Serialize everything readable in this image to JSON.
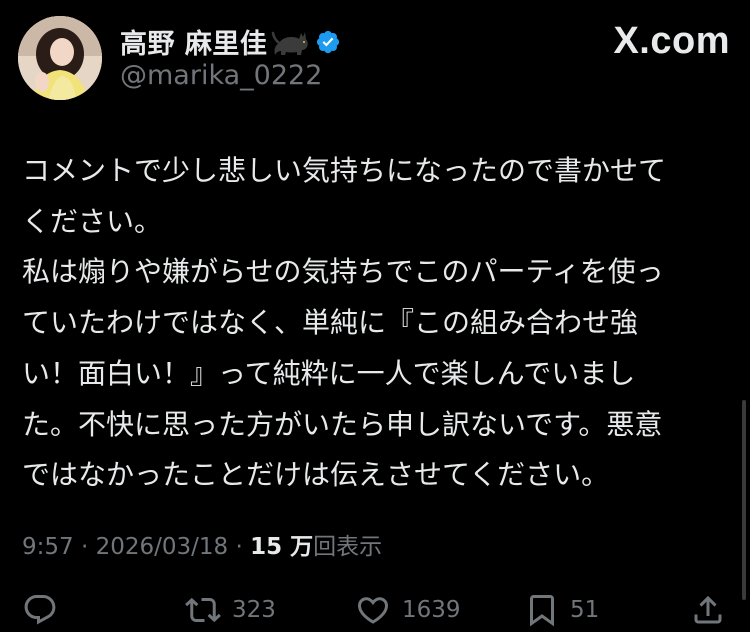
{
  "header": {
    "display_name": "高野 麻里佳",
    "handle": "@marika_0222",
    "site_logo": "X.com",
    "icons": [
      "black-cat-emoji-icon",
      "verified-badge-icon"
    ],
    "verified_color": "#1d9bf0"
  },
  "tweet": {
    "lines": [
      "コメントで少し悲しい気持ちになったので書かせて",
      "ください。",
      "私は煽りや嫌がらせの気持ちでこのパーティを使っ",
      "ていたわけではなく、単純に『この組み合わせ強",
      "い！面白い！』って純粋に一人で楽しんでいまし",
      "た。不快に思った方がいたら申し訳ないです。悪意",
      "ではなかったことだけは伝えさせてください。"
    ]
  },
  "meta": {
    "time": "9:57",
    "date": "2026/03/18",
    "separator": " · ",
    "views_count": "15 万",
    "views_label": "回表示"
  },
  "actions": {
    "reply_icon": "reply-icon",
    "retweet_count": "323",
    "like_count": "1639",
    "bookmark_count": "51",
    "share_icon": "share-icon"
  }
}
